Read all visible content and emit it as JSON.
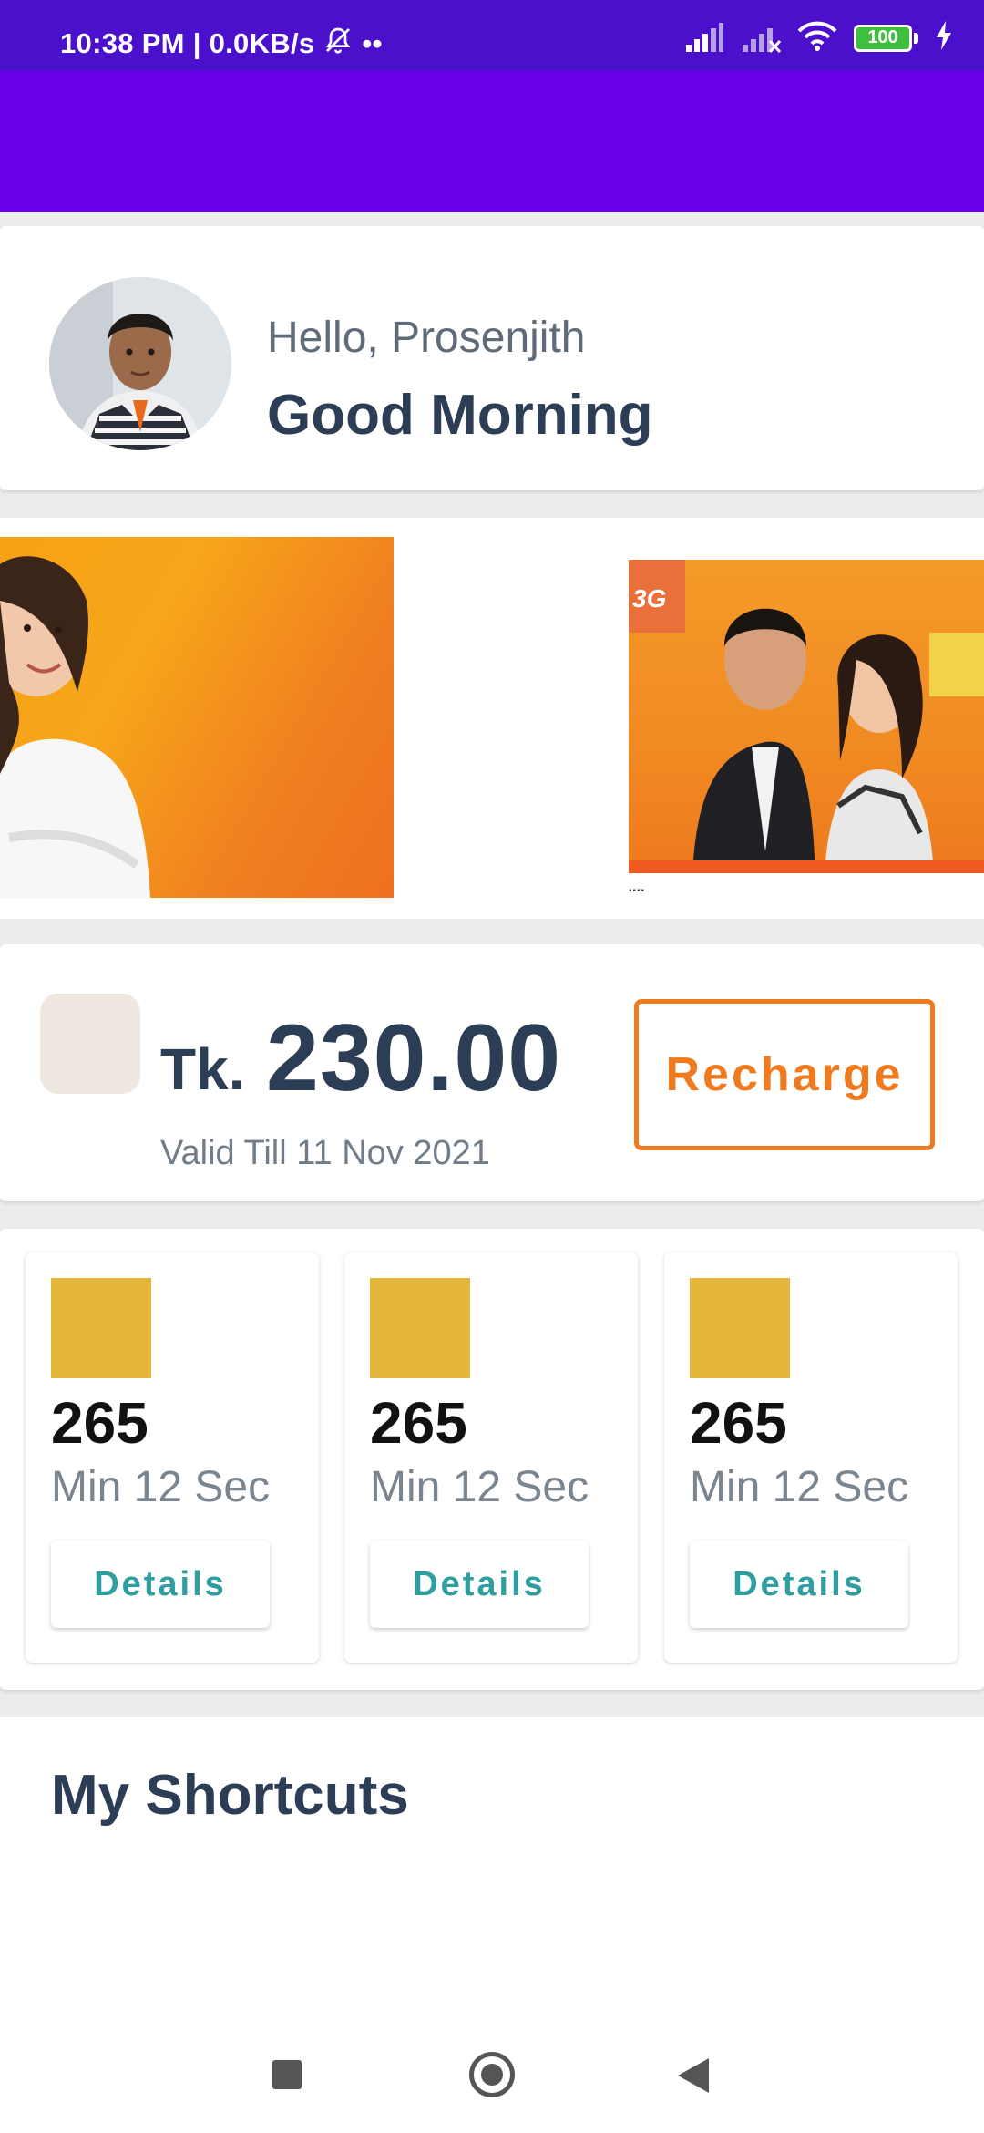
{
  "status_bar": {
    "time_speed": "10:38 PM | 0.0KB/s",
    "dots": "••",
    "battery": "100"
  },
  "greeting": {
    "hello": "Hello, Prosenjith",
    "salutation": "Good Morning"
  },
  "balance": {
    "currency": "Tk.",
    "amount": "230.00",
    "valid": "Valid Till 11 Nov 2021",
    "recharge_label": "Recharge"
  },
  "usage": [
    {
      "value": "265",
      "unit": "Min 12 Sec",
      "details_label": "Details"
    },
    {
      "value": "265",
      "unit": "Min 12 Sec",
      "details_label": "Details"
    },
    {
      "value": "265",
      "unit": "Min 12 Sec",
      "details_label": "Details"
    }
  ],
  "shortcuts": {
    "title": "My Shortcuts"
  },
  "colors": {
    "status_bar": "#4a10cc",
    "app_bar": "#6a00e8",
    "accent_orange": "#f07a1e",
    "details_teal": "#2f9e9e",
    "usage_icon": "#e4b73a",
    "title_navy": "#2c3e55"
  },
  "icons": {
    "mute": "bell-off-icon",
    "signal": "signal-icon",
    "wifi": "wifi-icon",
    "battery": "battery-icon",
    "charging": "charging-bolt-icon"
  }
}
